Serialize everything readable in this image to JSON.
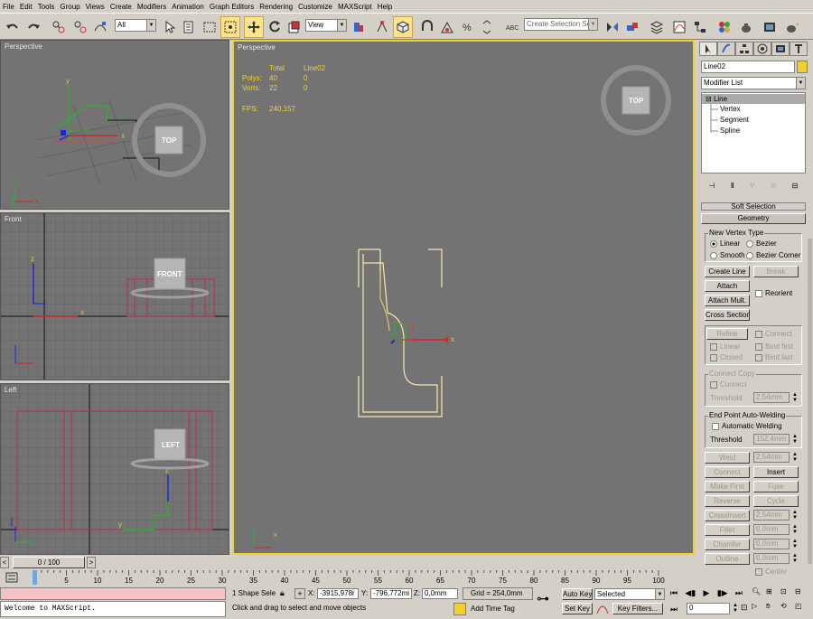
{
  "menu": [
    "File",
    "Edit",
    "Tools",
    "Group",
    "Views",
    "Create",
    "Modifiers",
    "Animation",
    "Graph Editors",
    "Rendering",
    "Customize",
    "MAXScript",
    "Help"
  ],
  "toolbar": {
    "filter_value": "All",
    "ref_coord_value": "View",
    "named_selection_placeholder": "Create Selection Set"
  },
  "viewports": {
    "top_left": {
      "label": "Perspective",
      "cube": "TOP"
    },
    "front": {
      "label": "Front",
      "cube": "FRONT"
    },
    "left": {
      "label": "Left",
      "cube": "LEFT"
    },
    "main": {
      "label": "Perspective",
      "cube": "TOP",
      "stats": {
        "col_total": "Total",
        "col_obj": "Line02",
        "polys_label": "Polys:",
        "polys_total": "40",
        "polys_obj": "0",
        "verts_label": "Verts:",
        "verts_total": "22",
        "verts_obj": "0",
        "fps_label": "FPS:",
        "fps_value": "240,157"
      }
    }
  },
  "axes": {
    "x": "x",
    "y": "y",
    "z": "z"
  },
  "panel": {
    "object_name": "Line02",
    "modifier_list": "Modifier List",
    "stack": {
      "root": "Line",
      "items": [
        "Vertex",
        "Segment",
        "Spline"
      ]
    },
    "rollouts": {
      "soft_selection": "Soft Selection",
      "geometry": "Geometry"
    },
    "new_vertex_type": {
      "label": "New Vertex Type",
      "linear": "Linear",
      "bezier": "Bezier",
      "smooth": "Smooth",
      "bezier_corner": "Bezier Corner"
    },
    "buttons": {
      "create_line": "Create Line",
      "break": "Break",
      "attach": "Attach",
      "attach_mult": "Attach Mult.",
      "reorient": "Reorient",
      "cross_section": "Cross Section",
      "refine": "Refine",
      "connect": "Connect",
      "linear": "Linear",
      "bind_first": "Bind first",
      "closed": "Closed",
      "bind_last": "Bind last"
    },
    "connect_copy": {
      "label": "Connect Copy",
      "connect": "Connect",
      "threshold_label": "Threshold",
      "threshold_value": "2,54mm"
    },
    "end_point": {
      "label": "End Point Auto-Welding",
      "auto_weld": "Automatic Welding",
      "threshold_label": "Threshold",
      "threshold_value": "152,4mm"
    },
    "ops": {
      "weld": "Weld",
      "weld_value": "2,54mm",
      "connect": "Connect",
      "insert": "Insert",
      "make_first": "Make First",
      "fuse": "Fuse",
      "reverse": "Reverse",
      "cycle": "Cycle",
      "crossinsert": "CrossInsert",
      "crossinsert_value": "2,54mm",
      "fillet": "Fillet",
      "fillet_value": "0,0mm",
      "chamfer": "Chamfer",
      "chamfer_value": "0,0mm",
      "outline": "Outline",
      "outline_value": "0,0mm",
      "center": "Center"
    }
  },
  "timeline": {
    "slider": "0 / 100",
    "ticks": [
      "0",
      "5",
      "10",
      "15",
      "20",
      "25",
      "30",
      "35",
      "40",
      "45",
      "50",
      "55",
      "60",
      "65",
      "70",
      "75",
      "80",
      "85",
      "90",
      "95",
      "100"
    ]
  },
  "status": {
    "maxscript": "Welcome to MAXScript.",
    "selection": "1 Shape Sele",
    "x_label": "X:",
    "x_value": "-3915,978r",
    "y_label": "Y:",
    "y_value": "-796,772mi",
    "z_label": "Z:",
    "z_value": "0,0mm",
    "grid": "Grid = 254,0mm",
    "prompt": "Click and drag to select and move objects",
    "add_time_tag": "Add Time Tag",
    "auto_key": "Auto Key",
    "set_key": "Set Key",
    "key_mode": "Selected",
    "key_filters": "Key Filters...",
    "frame": "0"
  }
}
